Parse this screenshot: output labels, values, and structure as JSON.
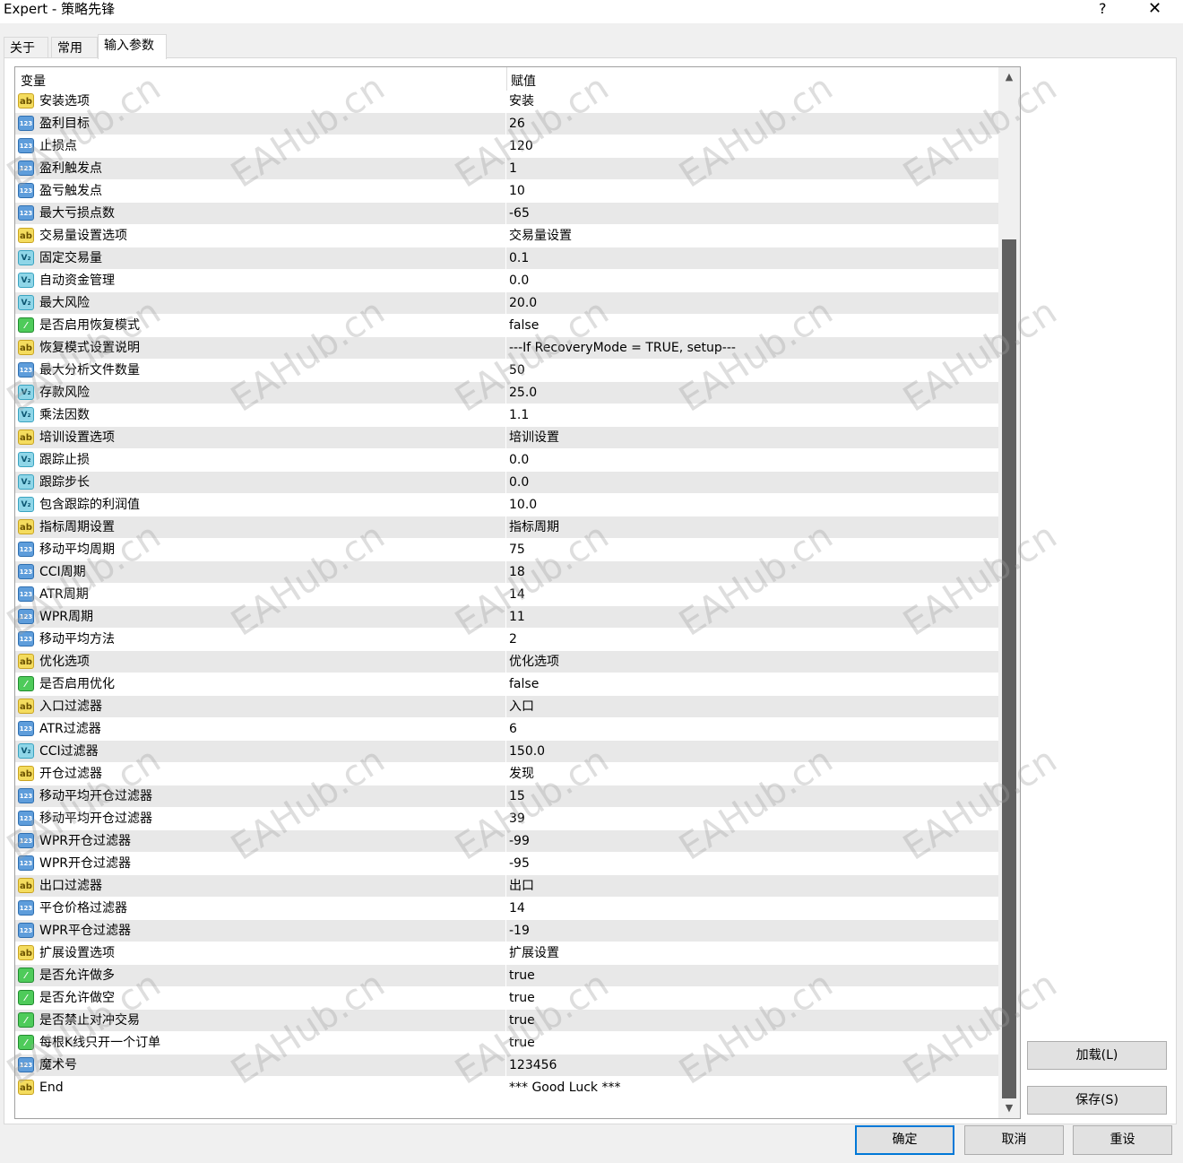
{
  "window": {
    "title": "Expert - 策略先锋",
    "help_glyph": "?",
    "close_glyph": "✕"
  },
  "tabs": [
    {
      "label": "关于",
      "active": false
    },
    {
      "label": "常用",
      "active": false
    },
    {
      "label": "输入参数",
      "active": true
    }
  ],
  "table": {
    "header": {
      "variable": "变量",
      "value": "赋值"
    },
    "rows": [
      {
        "type": "ab",
        "name": "安装选项",
        "value": "安装"
      },
      {
        "type": "123",
        "name": "盈利目标",
        "value": "26"
      },
      {
        "type": "123",
        "name": "止损点",
        "value": "120"
      },
      {
        "type": "123",
        "name": "盈利触发点",
        "value": "1"
      },
      {
        "type": "123",
        "name": "盈亏触发点",
        "value": "10"
      },
      {
        "type": "123",
        "name": "最大亏损点数",
        "value": "-65"
      },
      {
        "type": "ab",
        "name": "交易量设置选项",
        "value": "交易量设置"
      },
      {
        "type": "v2",
        "name": "固定交易量",
        "value": "0.1"
      },
      {
        "type": "v2",
        "name": "自动资金管理",
        "value": "0.0"
      },
      {
        "type": "v2",
        "name": "最大风险",
        "value": "20.0"
      },
      {
        "type": "bool",
        "name": "是否启用恢复模式",
        "value": "false"
      },
      {
        "type": "ab",
        "name": "恢复模式设置说明",
        "value": "---If RecoveryMode = TRUE, setup---"
      },
      {
        "type": "123",
        "name": "最大分析文件数量",
        "value": "50"
      },
      {
        "type": "v2",
        "name": "存款风险",
        "value": "25.0"
      },
      {
        "type": "v2",
        "name": "乘法因数",
        "value": "1.1"
      },
      {
        "type": "ab",
        "name": "培训设置选项",
        "value": "培训设置"
      },
      {
        "type": "v2",
        "name": "跟踪止损",
        "value": "0.0"
      },
      {
        "type": "v2",
        "name": "跟踪步长",
        "value": "0.0"
      },
      {
        "type": "v2",
        "name": "包含跟踪的利润值",
        "value": "10.0"
      },
      {
        "type": "ab",
        "name": "指标周期设置",
        "value": "指标周期"
      },
      {
        "type": "123",
        "name": "移动平均周期",
        "value": "75"
      },
      {
        "type": "123",
        "name": "CCI周期",
        "value": "18"
      },
      {
        "type": "123",
        "name": "ATR周期",
        "value": "14"
      },
      {
        "type": "123",
        "name": "WPR周期",
        "value": "11"
      },
      {
        "type": "123",
        "name": "移动平均方法",
        "value": "2"
      },
      {
        "type": "ab",
        "name": "优化选项",
        "value": "优化选项"
      },
      {
        "type": "bool",
        "name": "是否启用优化",
        "value": "false"
      },
      {
        "type": "ab",
        "name": "入口过滤器",
        "value": "入口"
      },
      {
        "type": "123",
        "name": "ATR过滤器",
        "value": "6"
      },
      {
        "type": "v2",
        "name": "CCI过滤器",
        "value": "150.0"
      },
      {
        "type": "ab",
        "name": "开仓过滤器",
        "value": "发现"
      },
      {
        "type": "123",
        "name": "移动平均开仓过滤器",
        "value": "15"
      },
      {
        "type": "123",
        "name": "移动平均开仓过滤器",
        "value": "39"
      },
      {
        "type": "123",
        "name": "WPR开仓过滤器",
        "value": "-99"
      },
      {
        "type": "123",
        "name": "WPR开仓过滤器",
        "value": "-95"
      },
      {
        "type": "ab",
        "name": "出口过滤器",
        "value": "出口"
      },
      {
        "type": "123",
        "name": "平仓价格过滤器",
        "value": "14"
      },
      {
        "type": "123",
        "name": "WPR平仓过滤器",
        "value": "-19"
      },
      {
        "type": "ab",
        "name": "扩展设置选项",
        "value": "扩展设置"
      },
      {
        "type": "bool",
        "name": "是否允许做多",
        "value": "true"
      },
      {
        "type": "bool",
        "name": "是否允许做空",
        "value": "true"
      },
      {
        "type": "bool",
        "name": "是否禁止对冲交易",
        "value": "true"
      },
      {
        "type": "bool",
        "name": "每根K线只开一个订单",
        "value": "true"
      },
      {
        "type": "123",
        "name": "魔术号",
        "value": "123456"
      },
      {
        "type": "ab",
        "name": "End",
        "value": "*** Good Luck ***"
      }
    ]
  },
  "icons": {
    "ab": {
      "glyph": "ab",
      "icon": "string-type-icon"
    },
    "123": {
      "glyph": "123",
      "icon": "integer-type-icon"
    },
    "v2": {
      "glyph": "V₂",
      "icon": "double-type-icon"
    },
    "bool": {
      "glyph": "⁄",
      "icon": "bool-type-icon"
    }
  },
  "side_buttons": {
    "load": "加载(L)",
    "save": "保存(S)"
  },
  "bottom_buttons": {
    "ok": "确定",
    "cancel": "取消",
    "reset": "重设"
  },
  "scroll": {
    "up_glyph": "▲",
    "down_glyph": "▼"
  },
  "watermark": "EAHub.cn"
}
